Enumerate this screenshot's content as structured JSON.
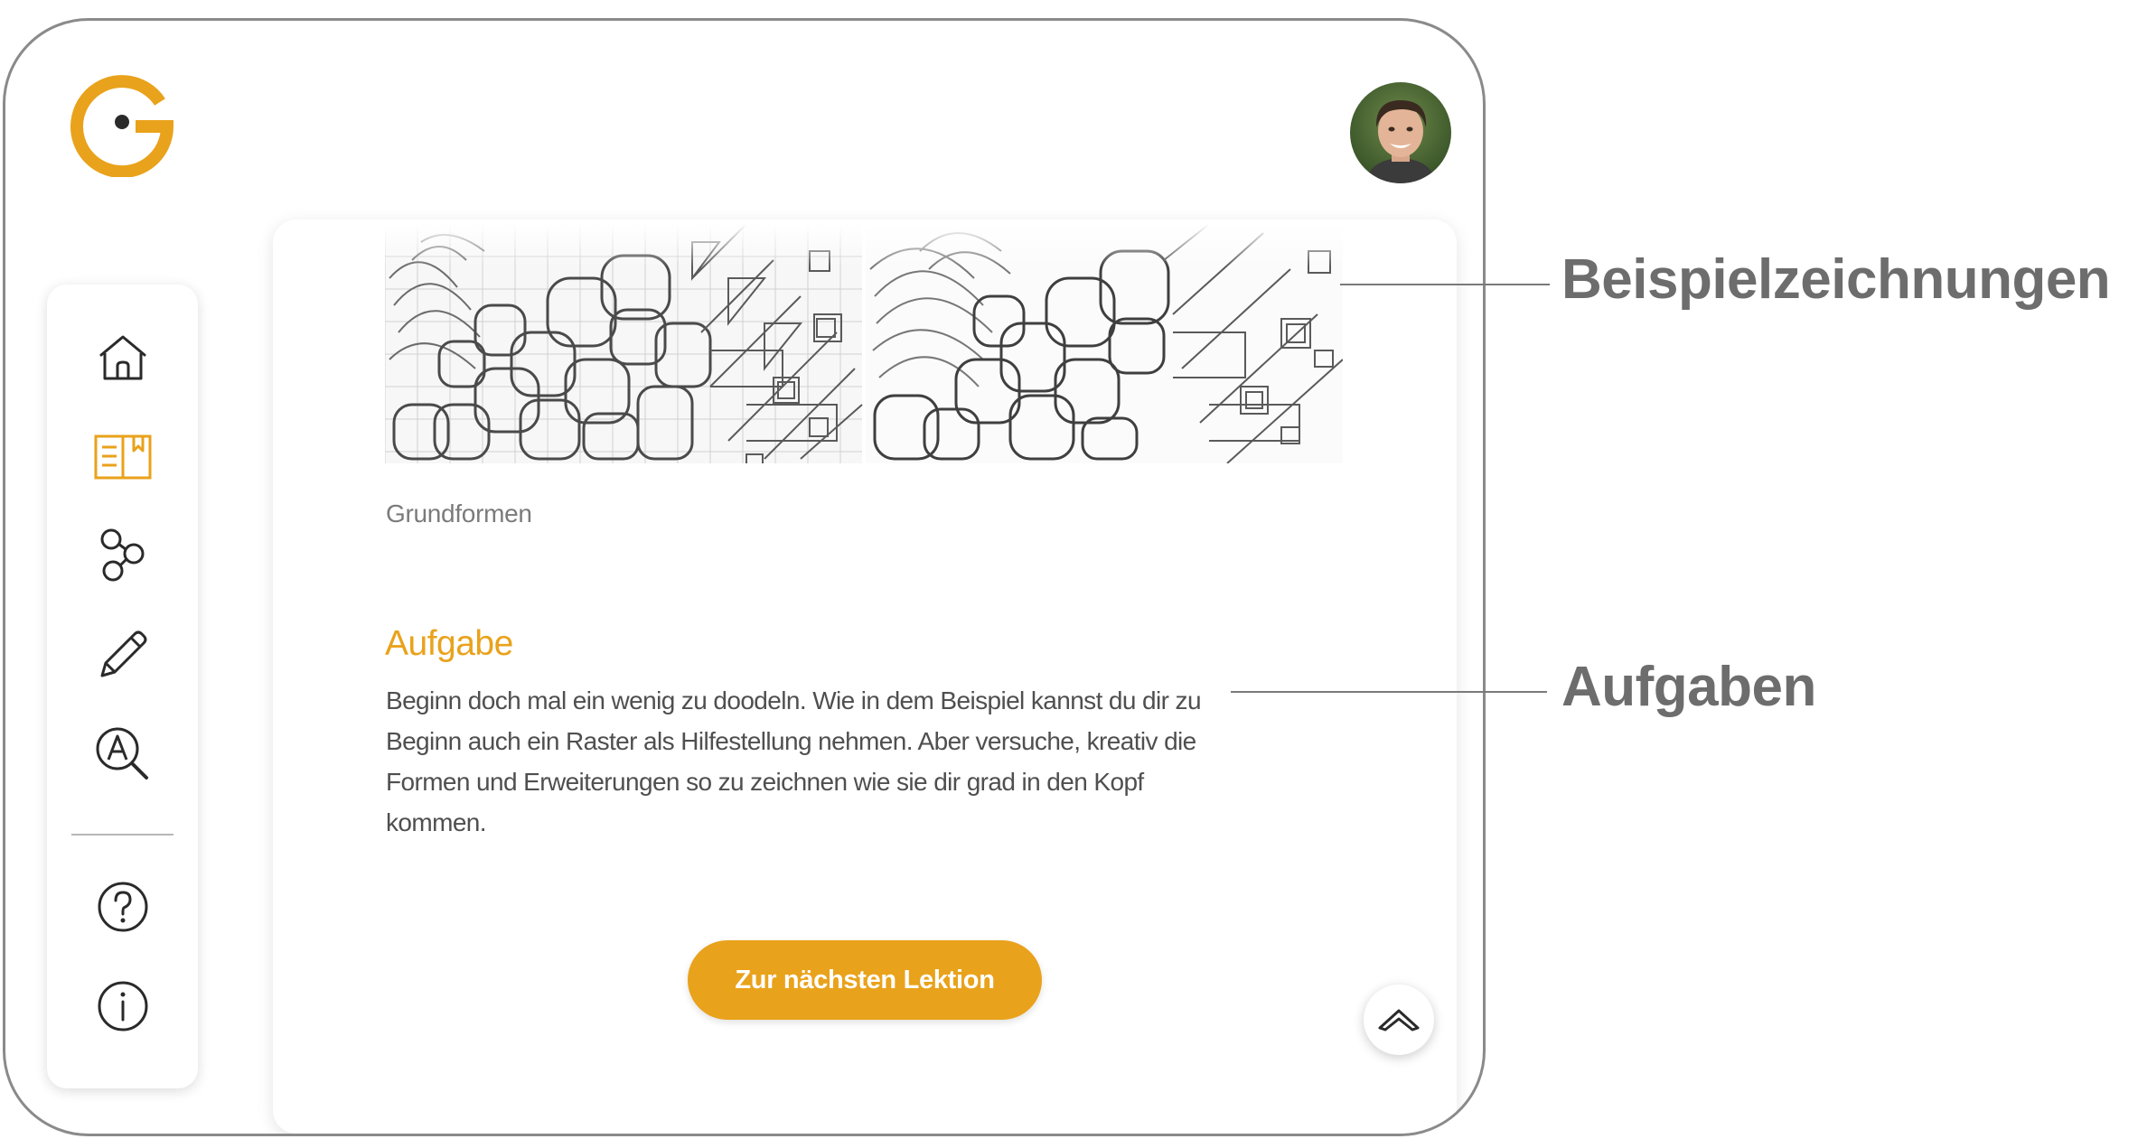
{
  "app": {
    "logo_icon": "g-logo-icon",
    "accent_color": "#e9a21b",
    "user_avatar": "user-avatar-photo"
  },
  "sidebar": {
    "items": [
      {
        "icon": "home-icon",
        "active": false
      },
      {
        "icon": "book-icon",
        "active": true
      },
      {
        "icon": "molecule-icon",
        "active": false
      },
      {
        "icon": "pencil-icon",
        "active": false
      },
      {
        "icon": "font-search-icon",
        "active": false
      }
    ],
    "bottom_items": [
      {
        "icon": "help-icon"
      },
      {
        "icon": "info-icon"
      }
    ]
  },
  "lesson": {
    "image_caption": "Grundformen",
    "task_heading": "Aufgabe",
    "task_text": "Beginn doch mal ein wenig zu doodeln. Wie in dem Beispiel kannst du dir zu Beginn auch ein Raster als Hilfestellung nehmen. Aber versuche, kreativ die Formen und Erweiterungen so zu zeichnen wie sie dir grad in den Kopf kommen.",
    "next_button_label": "Zur nächsten Lektion",
    "scroll_top_icon": "chevron-up-icon"
  },
  "annotations": {
    "examples_label": "Beispielzeichnungen",
    "tasks_label": "Aufgaben"
  }
}
